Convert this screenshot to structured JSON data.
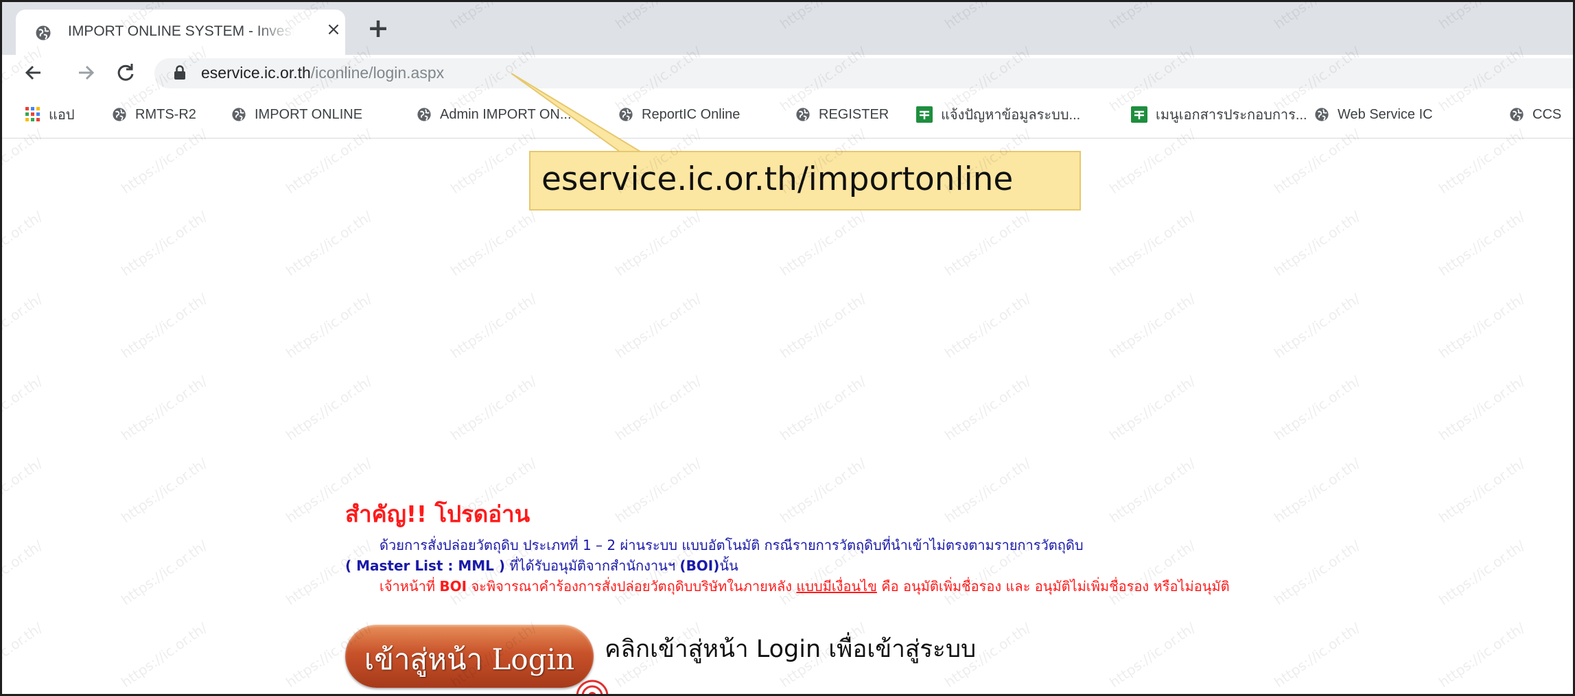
{
  "browser": {
    "tab_title": "IMPORT ONLINE SYSTEM - Invest",
    "tab_close": "×",
    "new_tab": "+",
    "url_host": "eservice.ic.or.th",
    "url_path": "/iconline/login.aspx"
  },
  "bookmarks": [
    {
      "label": "แอป",
      "icon": "apps-grid-icon"
    },
    {
      "label": "RMTS-R2",
      "icon": "globe-icon"
    },
    {
      "label": "IMPORT ONLINE",
      "icon": "globe-icon"
    },
    {
      "label": "Admin IMPORT ON...",
      "icon": "globe-icon"
    },
    {
      "label": "ReportIC Online",
      "icon": "globe-icon"
    },
    {
      "label": "REGISTER",
      "icon": "globe-icon"
    },
    {
      "label": "แจ้งปัญหาข้อมูลระบบ...",
      "icon": "sheets-icon"
    },
    {
      "label": "เมนูเอกสารประกอบการ...",
      "icon": "sheets-icon"
    },
    {
      "label": "Web Service IC",
      "icon": "globe-icon"
    },
    {
      "label": "CCS",
      "icon": "globe-icon"
    }
  ],
  "callout": {
    "text": "eservice.ic.or.th/importonline"
  },
  "notice": {
    "title": "สำคัญ!! โปรดอ่าน",
    "line1": "ด้วยการสั่งปล่อยวัตถุดิบ ประเภทที่ 1 – 2 ผ่านระบบ แบบอัตโนมัติ กรณีรายการวัตถุดิบที่นำเข้าไม่ตรงตามรายการวัตถุดิบ",
    "line2_a": "( Master List : MML )",
    "line2_b": " ที่ได้รับอนุมัติจากสำนักงานฯ ",
    "line2_c": "(BOI)",
    "line2_d": "นั้น",
    "line3_a": "เจ้าหน้าที่ ",
    "line3_b": "BOI",
    "line3_c": " จะพิจารณาคำร้องการสั่งปล่อยวัตถุดิบบริษัทในภายหลัง ",
    "line3_d": "แบบมีเงื่อนไข",
    "line3_e": " คือ อนุมัติเพิ่มชื่อรอง และ อนุมัติไม่เพิ่มชื่อรอง หรือไม่อนุมัติ"
  },
  "login": {
    "button_label": "เข้าสู่หน้า Login",
    "caption": "คลิกเข้าสู่หน้า Login เพื่อเข้าสู่ระบบ"
  },
  "watermark": {
    "text": "https://ic.or.th/"
  },
  "colors": {
    "notice_red": "#ff1a1a",
    "notice_blue": "#1a1aaa",
    "callout_bg": "#fbe6a2",
    "button_orange": "#c8522a"
  }
}
